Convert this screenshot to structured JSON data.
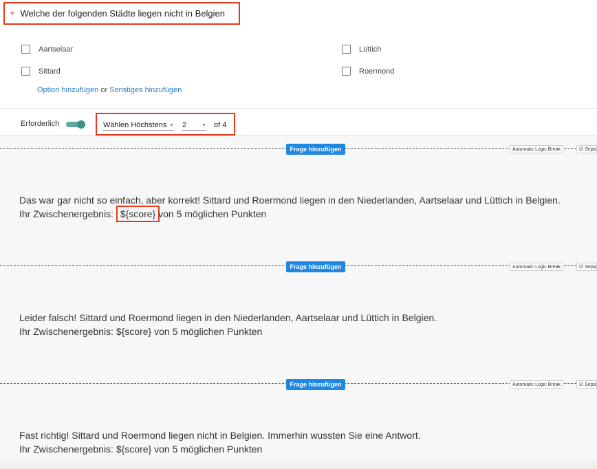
{
  "question": {
    "required_marker": "*",
    "title": "Welche der folgenden Städte liegen nicht in Belgien",
    "options": [
      "Aartselaar",
      "Lüttich",
      "Sittard",
      "Roermond"
    ],
    "add_option_link": "Option hinzufügen",
    "or_text": "or",
    "add_other_link": "Sonstiges hinzufügen",
    "required_label": "Erforderlich",
    "required_on": true,
    "max_mode": "Wählen Höchstens",
    "max_value": "2",
    "max_of": "of 4"
  },
  "separators": [
    {
      "add_button": "Frage hinzufügen",
      "logic_break": "Automatic Logic Break",
      "separate": "☑ Separ"
    },
    {
      "add_button": "Frage hinzufügen",
      "logic_break": "Automatic Logic Break",
      "separate": "☑ Separ"
    },
    {
      "add_button": "Frage hinzufügen",
      "logic_break": "Automatic Logic Break",
      "separate": "☑ Separ"
    }
  ],
  "messages": [
    {
      "line1": "Das war gar nicht so einfach, aber korrekt! Sittard und Roermond liegen in den Niederlanden, Aartselaar und Lüttich in Belgien.",
      "prefix": "Ihr Zwischenergebnis: ",
      "score": "${score}",
      "suffix": " von 5 möglichen Punkten"
    },
    {
      "line1": "Leider falsch! Sittard und Roermond liegen in den Niederlanden, Aartselaar und Lüttich in Belgien.",
      "prefix": "Ihr Zwischenergebnis: ",
      "score": "${score}",
      "suffix": " von 5 möglichen Punkten"
    },
    {
      "line1": "Fast richtig! Sittard und Roermond liegen nicht in Belgien. Immerhin wussten Sie eine Antwort.",
      "prefix": "Ihr Zwischenergebnis: ",
      "score": "${score}",
      "suffix": " von 5 möglichen Punkten"
    }
  ],
  "colors": {
    "highlight": "#e8371d",
    "accent_button": "#1f88e5",
    "link": "#2a7bc9",
    "toggle": "#5fa8a0"
  }
}
